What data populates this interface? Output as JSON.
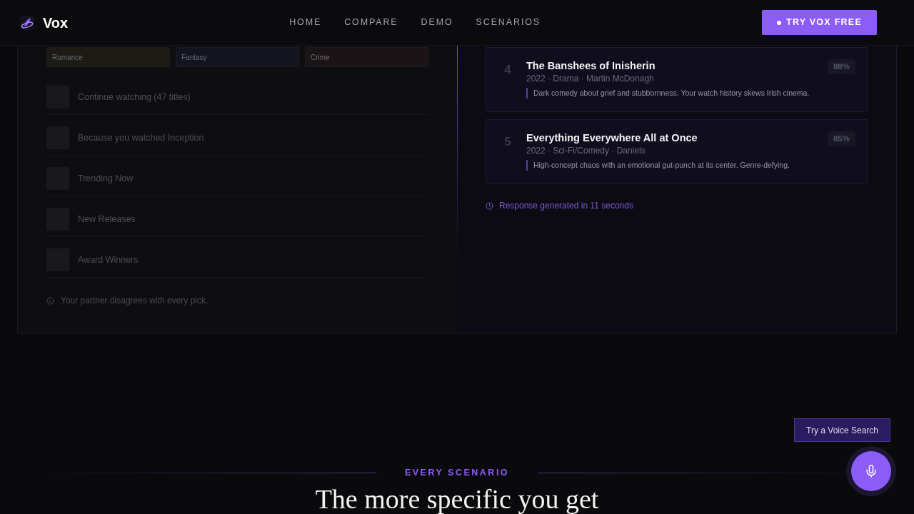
{
  "nav": {
    "brand": "Vox",
    "links": [
      {
        "label": "HOME"
      },
      {
        "label": "COMPARE"
      },
      {
        "label": "DEMO"
      },
      {
        "label": "SCENARIOS"
      }
    ],
    "cta": "TRY VOX FREE"
  },
  "comparison": {
    "without": {
      "genres": [
        {
          "label": "Romance",
          "color": "#1d1b15"
        },
        {
          "label": "Fantasy",
          "color": "#14141f"
        },
        {
          "label": "Crime",
          "color": "#1a1416"
        }
      ],
      "rows": [
        {
          "label": "Continue watching (47 titles)"
        },
        {
          "label": "Because you watched Inception"
        },
        {
          "label": "Trending Now"
        },
        {
          "label": "New Releases"
        },
        {
          "label": "Award Winners"
        }
      ],
      "note": "Your partner disagrees with every pick."
    },
    "with": {
      "results": [
        {
          "rank": "4",
          "title": "The Banshees of Inisherin",
          "meta": "2022 · Drama · Martin McDonagh",
          "reason": "Dark comedy about grief and stubbornness. Your watch history skews Irish cinema.",
          "match": "88%"
        },
        {
          "rank": "5",
          "title": "Everything Everywhere All at Once",
          "meta": "2022 · Sci-Fi/Comedy · Daniels",
          "reason": "High-concept chaos with an emotional gut-punch at its center. Genre-defying.",
          "match": "85%"
        }
      ],
      "note": "Response generated in 11 seconds"
    }
  },
  "voice": {
    "tooltip": "Try a Voice Search"
  },
  "section": {
    "eyebrow": "EVERY SCENARIO",
    "heading": "The more specific you get"
  }
}
